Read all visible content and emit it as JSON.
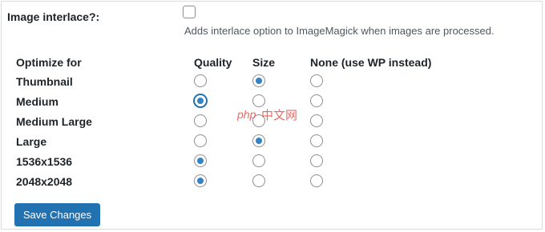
{
  "interlace": {
    "label": "Image interlace?:",
    "checked": false,
    "description": "Adds interlace option to ImageMagick when images are processed."
  },
  "table": {
    "headers": [
      "Optimize for",
      "Quality",
      "Size",
      "None (use WP instead)"
    ],
    "rows": [
      {
        "label": "Thumbnail",
        "selected": "Size"
      },
      {
        "label": "Medium",
        "selected": "Quality"
      },
      {
        "label": "Medium Large",
        "selected": "None"
      },
      {
        "label": "Large",
        "selected": "Size"
      },
      {
        "label": "1536x1536",
        "selected": "Quality"
      },
      {
        "label": "2048x2048",
        "selected": "Quality"
      }
    ]
  },
  "actions": {
    "save_label": "Save Changes"
  },
  "watermark": {
    "text_php": "php",
    "text_cn": "中文网"
  },
  "colors": {
    "accent": "#2271b1",
    "radio_dot": "#3582c4",
    "border": "#8c8f94",
    "watermark_red": "#e8352e"
  }
}
